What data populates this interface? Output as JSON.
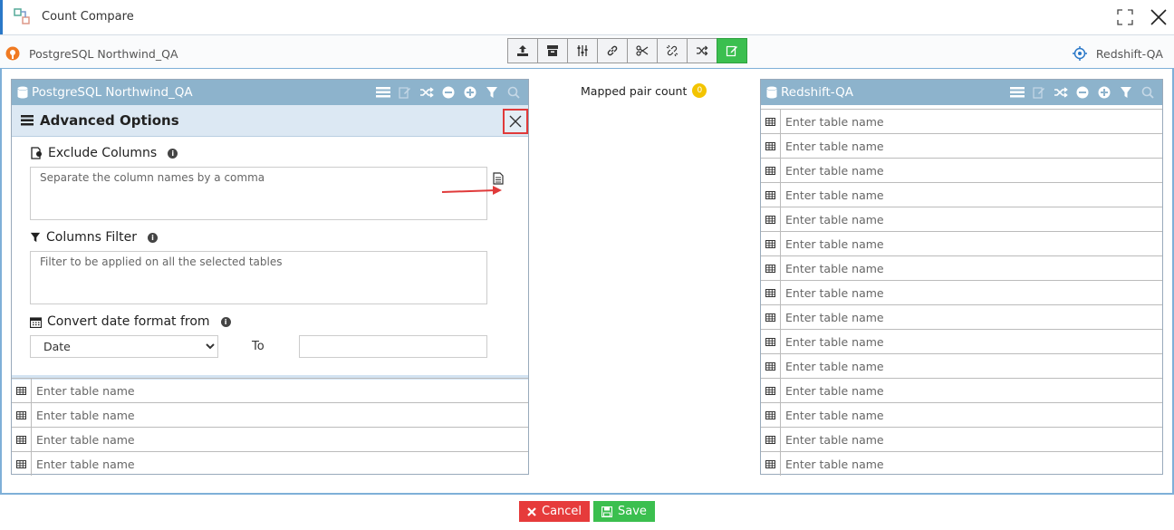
{
  "window": {
    "title": "Count Compare"
  },
  "source": {
    "connection": "PostgreSQL Northwind_QA",
    "panel_title": "PostgreSQL Northwind_QA"
  },
  "target": {
    "connection": "Redshift-QA",
    "panel_title": "Redshift-QA"
  },
  "mapped": {
    "label": "Mapped pair count",
    "count": "0"
  },
  "advanced": {
    "title": "Advanced Options",
    "exclude_label": "Exclude Columns",
    "exclude_placeholder": "Separate the column names by a comma",
    "filter_label": "Columns Filter",
    "filter_placeholder": "Filter to be applied on all the selected tables",
    "date_label": "Convert date format from",
    "date_selected": "Date",
    "to_label": "To"
  },
  "table_placeholder": "Enter table name",
  "source_rows": 4,
  "target_rows": 15,
  "footer": {
    "cancel": "Cancel",
    "save": "Save"
  },
  "colors": {
    "header": "#8db3cc",
    "accent_green": "#3bbf4f",
    "accent_red": "#e63b3b",
    "badge": "#f3c400"
  }
}
